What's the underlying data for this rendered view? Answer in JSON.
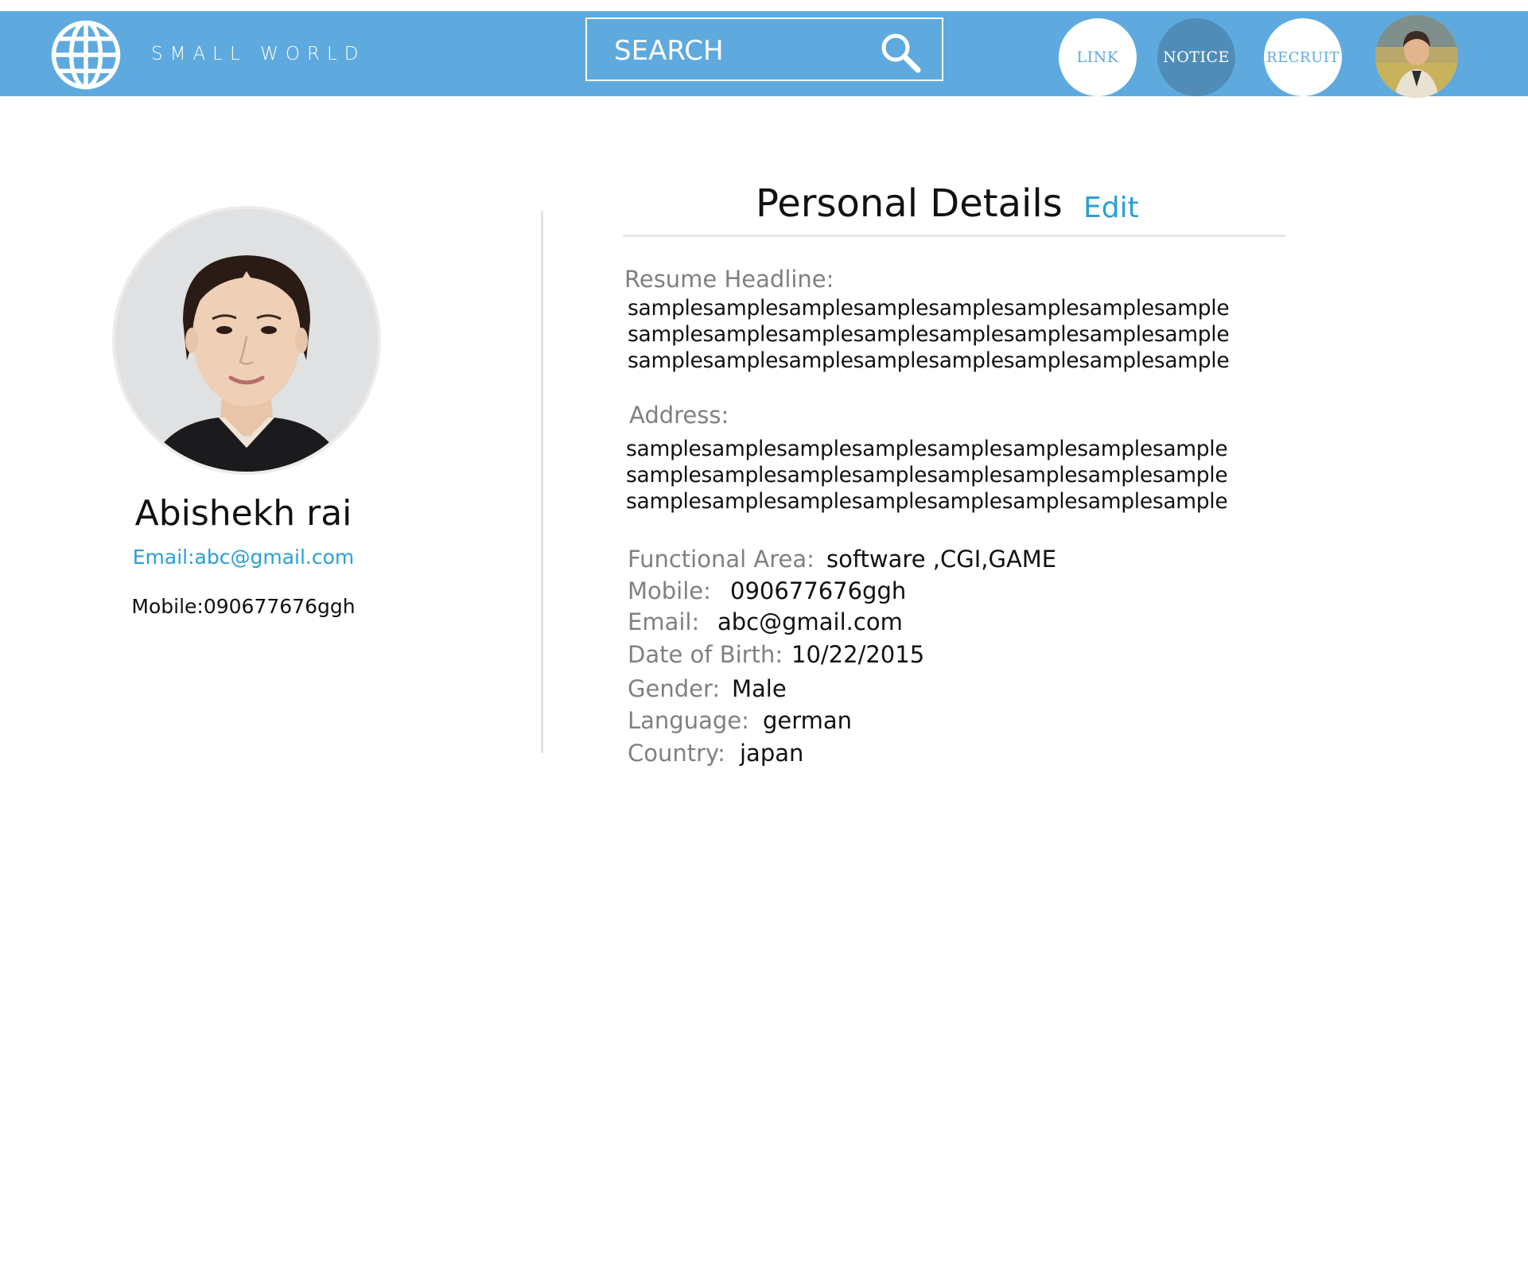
{
  "header": {
    "brand": "SMALL WORLD",
    "search": {
      "placeholder": "SEARCH"
    },
    "nav": {
      "link": "LINK",
      "notice": "NOTICE",
      "recruit": "RECRUIT"
    }
  },
  "profile": {
    "name": "Abishekh rai",
    "email": "Email:abc@gmail.com",
    "mobile": "Mobile:090677676ggh"
  },
  "details": {
    "title": "Personal Details",
    "edit_label": "Edit",
    "resume_headline": {
      "label": "Resume Headline:",
      "lines": [
        "samplesamplesamplesamplesamplesamplesamplesample",
        "samplesamplesamplesamplesamplesamplesamplesample",
        "samplesamplesamplesamplesamplesamplesamplesample"
      ]
    },
    "address": {
      "label": "Address:",
      "lines": [
        "samplesamplesamplesamplesamplesamplesamplesample",
        "samplesamplesamplesamplesamplesamplesamplesample",
        "samplesamplesamplesamplesamplesamplesamplesample"
      ]
    },
    "fields": [
      {
        "label": "Functional Area:",
        "value": "software ,CGI,GAME"
      },
      {
        "label": "Mobile:",
        "value": "090677676ggh"
      },
      {
        "label": "Email:",
        "value": "abc@gmail.com"
      },
      {
        "label": "Date of Birth:",
        "value": "10/22/2015"
      },
      {
        "label": "Gender:",
        "value": "Male"
      },
      {
        "label": "Language:",
        "value": "german"
      },
      {
        "label": "Country:",
        "value": "japan"
      }
    ]
  },
  "colors": {
    "header_bg": "#5eaade",
    "notice_bg": "#4f8db8",
    "accent": "#2a9fd8",
    "label_gray": "#808080"
  },
  "icons": [
    "globe-icon",
    "search-icon"
  ]
}
